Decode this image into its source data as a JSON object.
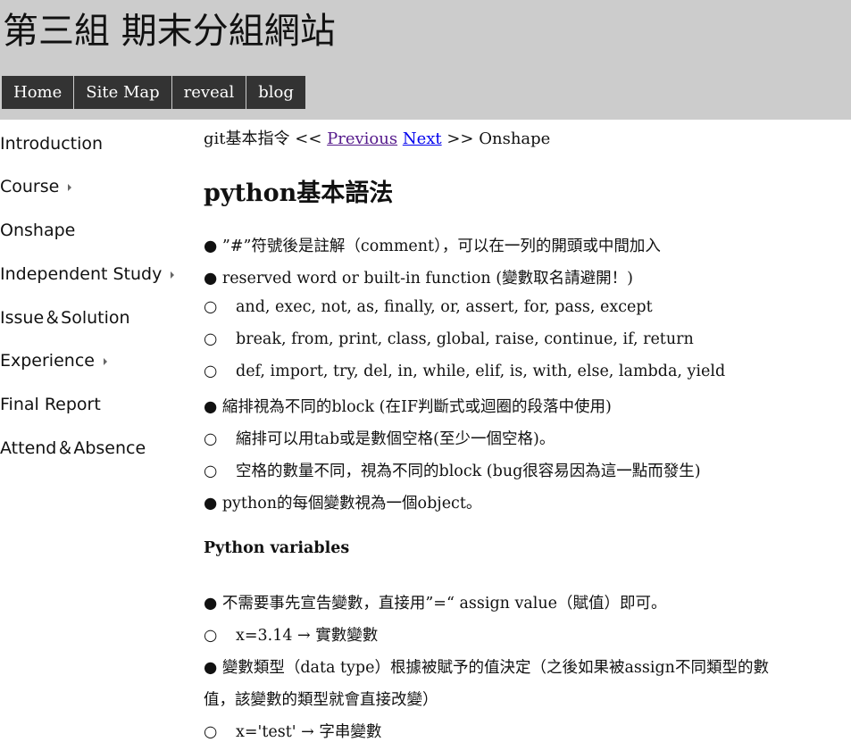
{
  "site": {
    "title": "第三組 期末分組網站"
  },
  "nav": {
    "tabs": [
      "Home",
      "Site Map",
      "reveal",
      "blog"
    ]
  },
  "sidebar": {
    "items": [
      {
        "label": "Introduction",
        "has_submenu": false
      },
      {
        "label": "Course",
        "has_submenu": true
      },
      {
        "label": "Onshape",
        "has_submenu": false
      },
      {
        "label": "Independent Study",
        "has_submenu": true
      },
      {
        "label": "Issue＆Solution",
        "has_submenu": false
      },
      {
        "label": "Experience",
        "has_submenu": true
      },
      {
        "label": "Final Report",
        "has_submenu": false
      },
      {
        "label": "Attend＆Absence",
        "has_submenu": false
      }
    ]
  },
  "breadcrumb": {
    "prev_page": "git基本指令",
    "prev_sep": " << ",
    "previous_label": "Previous",
    "next_label": "Next",
    "next_sep": " >> ",
    "next_page": "Onshape"
  },
  "main": {
    "heading": "python基本語法",
    "lines": [
      "● ”#”符號後是註解（comment），可以在一列的開頭或中間加入",
      "● reserved word or built-in function (變數取名請避開！)",
      "○",
      "and, exec, not, as, finally, or, assert, for, pass, except",
      "○",
      "break, from, print, class, global, raise, continue, if, return",
      "○",
      "def, import, try, del, in, while, elif, is, with, else, lambda, yield",
      "● 縮排視為不同的block (在IF判斷式或迴圈的段落中使用)",
      "○",
      "縮排可以用tab或是數個空格(至少一個空格)。",
      "○",
      "空格的數量不同，視為不同的block (bug很容易因為這一點而發生)",
      "● python的每個變數視為一個object。"
    ],
    "subheading": "Python variables",
    "lines2": [
      "● 不需要事先宣告變數，直接用”=“ assign value（賦值）即可。",
      "○",
      "x=3.14 → 實數變數",
      "● 變數類型（data type）根據被賦予的值決定（之後如果被assign不同類型的數",
      "值，該變數的類型就會直接改變）",
      "○",
      "x='test' → 字串變數"
    ]
  }
}
